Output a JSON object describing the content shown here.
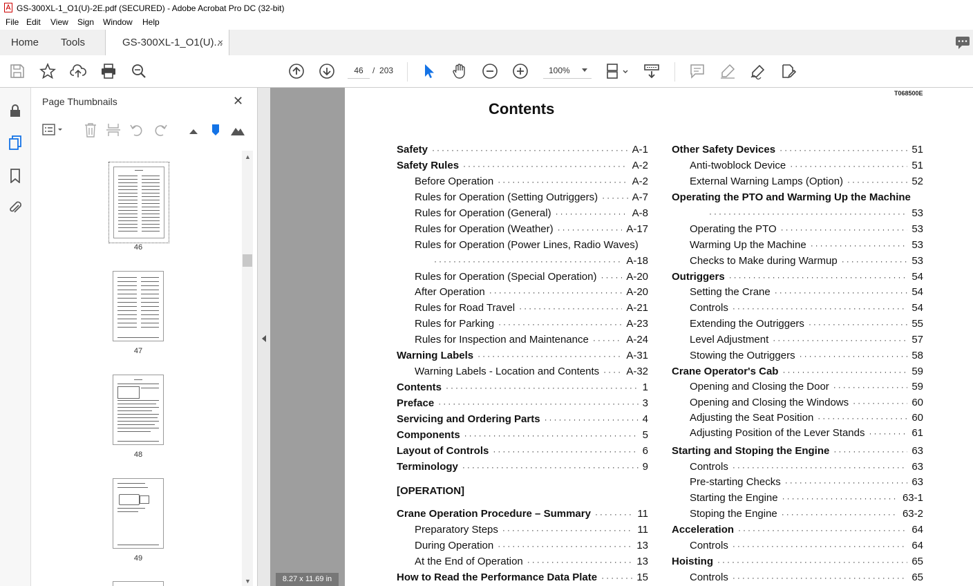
{
  "window": {
    "title": "GS-300XL-1_O1(U)-2E.pdf (SECURED) - Adobe Acrobat Pro DC (32-bit)"
  },
  "menu": [
    "File",
    "Edit",
    "View",
    "Sign",
    "Window",
    "Help"
  ],
  "tabs": {
    "home": "Home",
    "tools": "Tools",
    "document": "GS-300XL-1_O1(U)...",
    "close": "×"
  },
  "nav": {
    "current_page": "46",
    "separator": "/",
    "total_pages": "203",
    "zoom": "100%"
  },
  "panel": {
    "title": "Page Thumbnails",
    "close": "✕",
    "thumbnails": [
      "46",
      "47",
      "48",
      "49"
    ]
  },
  "page_size": "8.27 x 11.69 in",
  "document": {
    "code": "T068500E",
    "title": "Contents",
    "left_col": [
      {
        "label": "Safety",
        "page": "A-1",
        "bold": true
      },
      {
        "label": "Safety Rules",
        "page": "A-2",
        "bold": true
      },
      {
        "label": "Before Operation",
        "page": "A-2"
      },
      {
        "label": "Rules for Operation (Setting Outriggers)",
        "page": "A-7"
      },
      {
        "label": "Rules for Operation (General)",
        "page": "A-8"
      },
      {
        "label": "Rules for Operation (Weather)",
        "page": "A-17"
      },
      {
        "label": "Rules for Operation (Power Lines, Radio Waves)",
        "page": ""
      },
      {
        "label": "",
        "page": "A-18"
      },
      {
        "label": "Rules for Operation (Special Operation)",
        "page": "A-20"
      },
      {
        "label": "After Operation",
        "page": "A-20"
      },
      {
        "label": "Rules for Road Travel",
        "page": "A-21"
      },
      {
        "label": "Rules for Parking",
        "page": "A-23"
      },
      {
        "label": "Rules for Inspection and Maintenance",
        "page": "A-24"
      },
      {
        "label": "Warning Labels",
        "page": "A-31",
        "bold": true
      },
      {
        "label": "Warning Labels - Location and Contents",
        "page": "A-32"
      },
      {
        "label": "Contents",
        "page": "1",
        "bold": true
      },
      {
        "label": "Preface",
        "page": "3",
        "bold": true
      },
      {
        "label": "Servicing and Ordering Parts",
        "page": "4",
        "bold": true
      },
      {
        "label": "Components",
        "page": "5",
        "bold": true
      },
      {
        "label": "Layout of Controls",
        "page": "6",
        "bold": true
      },
      {
        "label": "Terminology",
        "page": "9",
        "bold": true
      },
      {
        "label": "[OPERATION]",
        "page": "",
        "bold": true
      },
      {
        "label": "Crane Operation Procedure – Summary",
        "page": "11",
        "bold": true
      },
      {
        "label": "Preparatory Steps",
        "page": "11"
      },
      {
        "label": "During Operation",
        "page": "13"
      },
      {
        "label": "At the End of Operation",
        "page": "13"
      },
      {
        "label": "How to Read the Performance Data Plate",
        "page": "15",
        "bold": true
      }
    ],
    "right_col": [
      {
        "label": "Other Safety Devices",
        "page": "51",
        "bold": true
      },
      {
        "label": "Anti-twoblock Device",
        "page": "51"
      },
      {
        "label": "External Warning Lamps (Option)",
        "page": "52"
      },
      {
        "label": "Operating the PTO and Warming Up the Machine",
        "page": "",
        "bold": true
      },
      {
        "label": "",
        "page": "53"
      },
      {
        "label": "Operating the PTO",
        "page": "53"
      },
      {
        "label": "Warming Up the Machine",
        "page": "53"
      },
      {
        "label": "Checks to Make during Warmup",
        "page": "53"
      },
      {
        "label": "Outriggers",
        "page": "54",
        "bold": true
      },
      {
        "label": "Setting the Crane",
        "page": "54"
      },
      {
        "label": "Controls",
        "page": "54"
      },
      {
        "label": "Extending the Outriggers",
        "page": "55"
      },
      {
        "label": "Level Adjustment",
        "page": "57"
      },
      {
        "label": "Stowing the Outriggers",
        "page": "58"
      },
      {
        "label": "Crane Operator's Cab",
        "page": "59",
        "bold": true
      },
      {
        "label": "Opening and Closing the Door",
        "page": "59"
      },
      {
        "label": "Opening and Closing the Windows",
        "page": "60"
      },
      {
        "label": "Adjusting the Seat Position",
        "page": "60"
      },
      {
        "label": "Adjusting Position of the Lever Stands",
        "page": "61"
      },
      {
        "label": "Starting and Stoping the Engine",
        "page": "63",
        "bold": true
      },
      {
        "label": "Controls",
        "page": "63"
      },
      {
        "label": "Pre-starting Checks",
        "page": "63"
      },
      {
        "label": "Starting the Engine",
        "page": "63-1"
      },
      {
        "label": "Stoping the Engine",
        "page": "63-2"
      },
      {
        "label": "Acceleration",
        "page": "64",
        "bold": true
      },
      {
        "label": "Controls",
        "page": "64"
      },
      {
        "label": "Hoisting",
        "page": "65",
        "bold": true
      },
      {
        "label": "Controls",
        "page": "65"
      }
    ]
  }
}
